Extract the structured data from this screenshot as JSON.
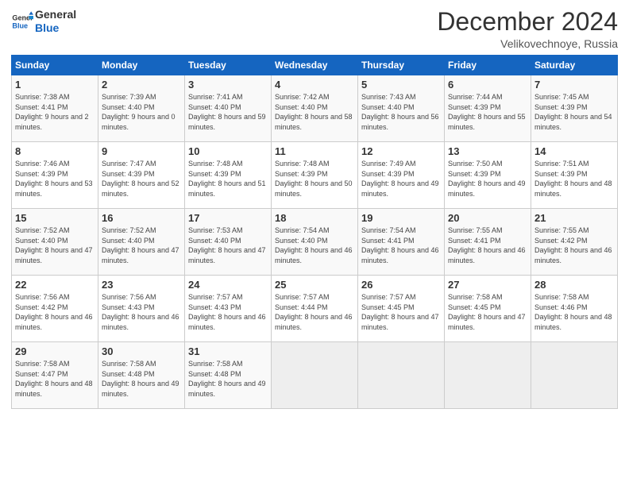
{
  "logo": {
    "line1": "General",
    "line2": "Blue"
  },
  "title": "December 2024",
  "subtitle": "Velikovechnoye, Russia",
  "header": {
    "accent_color": "#1565c0"
  },
  "days_of_week": [
    "Sunday",
    "Monday",
    "Tuesday",
    "Wednesday",
    "Thursday",
    "Friday",
    "Saturday"
  ],
  "weeks": [
    [
      {
        "day": "1",
        "sunrise": "Sunrise: 7:38 AM",
        "sunset": "Sunset: 4:41 PM",
        "daylight": "Daylight: 9 hours and 2 minutes."
      },
      {
        "day": "2",
        "sunrise": "Sunrise: 7:39 AM",
        "sunset": "Sunset: 4:40 PM",
        "daylight": "Daylight: 9 hours and 0 minutes."
      },
      {
        "day": "3",
        "sunrise": "Sunrise: 7:41 AM",
        "sunset": "Sunset: 4:40 PM",
        "daylight": "Daylight: 8 hours and 59 minutes."
      },
      {
        "day": "4",
        "sunrise": "Sunrise: 7:42 AM",
        "sunset": "Sunset: 4:40 PM",
        "daylight": "Daylight: 8 hours and 58 minutes."
      },
      {
        "day": "5",
        "sunrise": "Sunrise: 7:43 AM",
        "sunset": "Sunset: 4:40 PM",
        "daylight": "Daylight: 8 hours and 56 minutes."
      },
      {
        "day": "6",
        "sunrise": "Sunrise: 7:44 AM",
        "sunset": "Sunset: 4:39 PM",
        "daylight": "Daylight: 8 hours and 55 minutes."
      },
      {
        "day": "7",
        "sunrise": "Sunrise: 7:45 AM",
        "sunset": "Sunset: 4:39 PM",
        "daylight": "Daylight: 8 hours and 54 minutes."
      }
    ],
    [
      {
        "day": "8",
        "sunrise": "Sunrise: 7:46 AM",
        "sunset": "Sunset: 4:39 PM",
        "daylight": "Daylight: 8 hours and 53 minutes."
      },
      {
        "day": "9",
        "sunrise": "Sunrise: 7:47 AM",
        "sunset": "Sunset: 4:39 PM",
        "daylight": "Daylight: 8 hours and 52 minutes."
      },
      {
        "day": "10",
        "sunrise": "Sunrise: 7:48 AM",
        "sunset": "Sunset: 4:39 PM",
        "daylight": "Daylight: 8 hours and 51 minutes."
      },
      {
        "day": "11",
        "sunrise": "Sunrise: 7:48 AM",
        "sunset": "Sunset: 4:39 PM",
        "daylight": "Daylight: 8 hours and 50 minutes."
      },
      {
        "day": "12",
        "sunrise": "Sunrise: 7:49 AM",
        "sunset": "Sunset: 4:39 PM",
        "daylight": "Daylight: 8 hours and 49 minutes."
      },
      {
        "day": "13",
        "sunrise": "Sunrise: 7:50 AM",
        "sunset": "Sunset: 4:39 PM",
        "daylight": "Daylight: 8 hours and 49 minutes."
      },
      {
        "day": "14",
        "sunrise": "Sunrise: 7:51 AM",
        "sunset": "Sunset: 4:39 PM",
        "daylight": "Daylight: 8 hours and 48 minutes."
      }
    ],
    [
      {
        "day": "15",
        "sunrise": "Sunrise: 7:52 AM",
        "sunset": "Sunset: 4:40 PM",
        "daylight": "Daylight: 8 hours and 47 minutes."
      },
      {
        "day": "16",
        "sunrise": "Sunrise: 7:52 AM",
        "sunset": "Sunset: 4:40 PM",
        "daylight": "Daylight: 8 hours and 47 minutes."
      },
      {
        "day": "17",
        "sunrise": "Sunrise: 7:53 AM",
        "sunset": "Sunset: 4:40 PM",
        "daylight": "Daylight: 8 hours and 47 minutes."
      },
      {
        "day": "18",
        "sunrise": "Sunrise: 7:54 AM",
        "sunset": "Sunset: 4:40 PM",
        "daylight": "Daylight: 8 hours and 46 minutes."
      },
      {
        "day": "19",
        "sunrise": "Sunrise: 7:54 AM",
        "sunset": "Sunset: 4:41 PM",
        "daylight": "Daylight: 8 hours and 46 minutes."
      },
      {
        "day": "20",
        "sunrise": "Sunrise: 7:55 AM",
        "sunset": "Sunset: 4:41 PM",
        "daylight": "Daylight: 8 hours and 46 minutes."
      },
      {
        "day": "21",
        "sunrise": "Sunrise: 7:55 AM",
        "sunset": "Sunset: 4:42 PM",
        "daylight": "Daylight: 8 hours and 46 minutes."
      }
    ],
    [
      {
        "day": "22",
        "sunrise": "Sunrise: 7:56 AM",
        "sunset": "Sunset: 4:42 PM",
        "daylight": "Daylight: 8 hours and 46 minutes."
      },
      {
        "day": "23",
        "sunrise": "Sunrise: 7:56 AM",
        "sunset": "Sunset: 4:43 PM",
        "daylight": "Daylight: 8 hours and 46 minutes."
      },
      {
        "day": "24",
        "sunrise": "Sunrise: 7:57 AM",
        "sunset": "Sunset: 4:43 PM",
        "daylight": "Daylight: 8 hours and 46 minutes."
      },
      {
        "day": "25",
        "sunrise": "Sunrise: 7:57 AM",
        "sunset": "Sunset: 4:44 PM",
        "daylight": "Daylight: 8 hours and 46 minutes."
      },
      {
        "day": "26",
        "sunrise": "Sunrise: 7:57 AM",
        "sunset": "Sunset: 4:45 PM",
        "daylight": "Daylight: 8 hours and 47 minutes."
      },
      {
        "day": "27",
        "sunrise": "Sunrise: 7:58 AM",
        "sunset": "Sunset: 4:45 PM",
        "daylight": "Daylight: 8 hours and 47 minutes."
      },
      {
        "day": "28",
        "sunrise": "Sunrise: 7:58 AM",
        "sunset": "Sunset: 4:46 PM",
        "daylight": "Daylight: 8 hours and 48 minutes."
      }
    ],
    [
      {
        "day": "29",
        "sunrise": "Sunrise: 7:58 AM",
        "sunset": "Sunset: 4:47 PM",
        "daylight": "Daylight: 8 hours and 48 minutes."
      },
      {
        "day": "30",
        "sunrise": "Sunrise: 7:58 AM",
        "sunset": "Sunset: 4:48 PM",
        "daylight": "Daylight: 8 hours and 49 minutes."
      },
      {
        "day": "31",
        "sunrise": "Sunrise: 7:58 AM",
        "sunset": "Sunset: 4:48 PM",
        "daylight": "Daylight: 8 hours and 49 minutes."
      },
      null,
      null,
      null,
      null
    ]
  ]
}
